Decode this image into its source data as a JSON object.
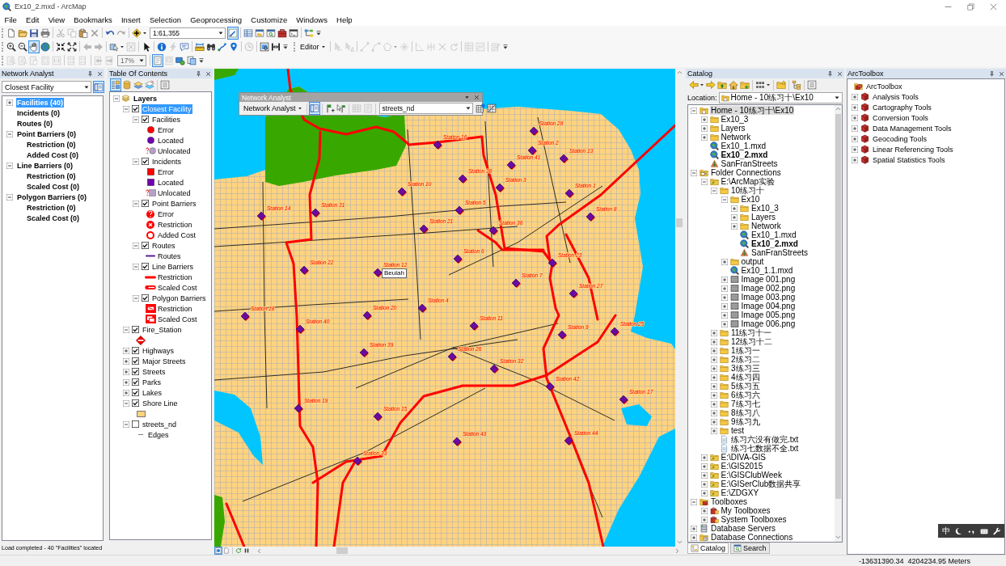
{
  "window": {
    "title": "Ex10_2.mxd - ArcMap"
  },
  "menu": [
    "File",
    "Edit",
    "View",
    "Bookmarks",
    "Insert",
    "Selection",
    "Geoprocessing",
    "Customize",
    "Windows",
    "Help"
  ],
  "toolbar_rows": [
    [
      {
        "items": [
          {
            "kind": "new",
            "selected": false,
            "disabled": false
          },
          {
            "kind": "open",
            "selected": false,
            "disabled": false
          },
          {
            "kind": "save",
            "selected": false,
            "disabled": false
          },
          {
            "kind": "print",
            "selected": false,
            "disabled": false
          },
          {
            "kind": "sep"
          },
          {
            "kind": "cut",
            "selected": false,
            "disabled": true
          },
          {
            "kind": "copy",
            "selected": false,
            "disabled": true
          },
          {
            "kind": "paste",
            "selected": false,
            "disabled": false
          },
          {
            "kind": "delete",
            "selected": false,
            "disabled": true
          },
          {
            "kind": "sep"
          },
          {
            "kind": "undo",
            "selected": false,
            "disabled": false
          },
          {
            "kind": "redo",
            "selected": false,
            "disabled": true
          },
          {
            "kind": "sep"
          },
          {
            "kind": "adddata",
            "selected": false,
            "disabled": false,
            "dropdown": true
          },
          {
            "kind": "combo",
            "value": "1:61,355",
            "disabled": false
          },
          {
            "kind": "editortb",
            "selected": true,
            "disabled": false
          },
          {
            "kind": "sep"
          },
          {
            "kind": "table",
            "selected": false,
            "disabled": false
          },
          {
            "kind": "catalog",
            "selected": false,
            "disabled": false
          },
          {
            "kind": "search",
            "selected": false,
            "disabled": false
          },
          {
            "kind": "toolbox",
            "selected": false,
            "disabled": false
          },
          {
            "kind": "python",
            "selected": false,
            "disabled": false
          },
          {
            "kind": "sep"
          },
          {
            "kind": "model",
            "selected": false,
            "disabled": false
          },
          {
            "kind": "options",
            "selected": false,
            "disabled": false
          }
        ]
      }
    ],
    [
      {
        "items": [
          {
            "kind": "zoomin",
            "selected": false,
            "disabled": false
          },
          {
            "kind": "zoomout",
            "selected": false,
            "disabled": false
          },
          {
            "kind": "pan",
            "selected": true,
            "disabled": false
          },
          {
            "kind": "fullextent",
            "selected": false,
            "disabled": false
          },
          {
            "kind": "sep"
          },
          {
            "kind": "fixedin",
            "selected": false,
            "disabled": false
          },
          {
            "kind": "fixedout",
            "selected": false,
            "disabled": false
          },
          {
            "kind": "sep"
          },
          {
            "kind": "back",
            "selected": false,
            "disabled": true
          },
          {
            "kind": "forward",
            "selected": false,
            "disabled": true
          },
          {
            "kind": "sep"
          },
          {
            "kind": "selectfeat",
            "selected": false,
            "disabled": false,
            "dropdown": true
          },
          {
            "kind": "clearsel",
            "selected": false,
            "disabled": true
          },
          {
            "kind": "sep"
          },
          {
            "kind": "pointer",
            "selected": false,
            "disabled": false
          },
          {
            "kind": "sep"
          },
          {
            "kind": "identify",
            "selected": false,
            "disabled": false
          },
          {
            "kind": "hyperlink",
            "selected": false,
            "disabled": true
          },
          {
            "kind": "popup",
            "selected": false,
            "disabled": false
          },
          {
            "kind": "sep"
          },
          {
            "kind": "measure",
            "selected": false,
            "disabled": false
          },
          {
            "kind": "find",
            "selected": false,
            "disabled": false
          },
          {
            "kind": "route",
            "selected": false,
            "disabled": false
          },
          {
            "kind": "gotoxy",
            "selected": false,
            "disabled": false
          },
          {
            "kind": "sep"
          },
          {
            "kind": "timeslider",
            "selected": false,
            "disabled": true
          },
          {
            "kind": "sep"
          },
          {
            "kind": "viewer",
            "selected": false,
            "disabled": false
          },
          {
            "kind": "swipe",
            "selected": false,
            "disabled": false
          },
          {
            "kind": "options",
            "selected": false,
            "disabled": false
          }
        ]
      },
      {
        "items": [
          {
            "kind": "menu",
            "label": "Editor",
            "disabled": false
          },
          {
            "kind": "sep"
          },
          {
            "kind": "edittool",
            "selected": false,
            "disabled": true
          },
          {
            "kind": "annot",
            "selected": false,
            "disabled": true
          },
          {
            "kind": "sep"
          },
          {
            "kind": "line",
            "selected": false,
            "disabled": true
          },
          {
            "kind": "arc",
            "selected": false,
            "disabled": true
          },
          {
            "kind": "polygon",
            "selected": false,
            "disabled": true,
            "dropdown": true
          },
          {
            "kind": "point",
            "selected": false,
            "disabled": true
          },
          {
            "kind": "sep"
          },
          {
            "kind": "split",
            "selected": false,
            "disabled": true
          },
          {
            "kind": "trace",
            "selected": false,
            "disabled": true
          },
          {
            "kind": "cross",
            "selected": false,
            "disabled": true
          },
          {
            "kind": "rotate",
            "selected": false,
            "disabled": true
          },
          {
            "kind": "sep"
          },
          {
            "kind": "attributes",
            "selected": false,
            "disabled": true
          },
          {
            "kind": "sketch",
            "selected": false,
            "disabled": true
          },
          {
            "kind": "sep"
          },
          {
            "kind": "create",
            "selected": false,
            "disabled": true
          },
          {
            "kind": "options",
            "selected": false,
            "disabled": false
          }
        ]
      }
    ],
    [
      {
        "items": [
          {
            "kind": "lzoomin",
            "selected": false,
            "disabled": true
          },
          {
            "kind": "lzoomout",
            "selected": false,
            "disabled": true
          },
          {
            "kind": "lpan",
            "selected": false,
            "disabled": true
          },
          {
            "kind": "fullpage",
            "selected": false,
            "disabled": true
          },
          {
            "kind": "actual",
            "selected": false,
            "disabled": true
          },
          {
            "kind": "sep"
          },
          {
            "kind": "lfixedin",
            "selected": false,
            "disabled": true
          },
          {
            "kind": "lfixedout",
            "selected": false,
            "disabled": true
          },
          {
            "kind": "sep"
          },
          {
            "kind": "lback",
            "selected": false,
            "disabled": true
          },
          {
            "kind": "lforward",
            "selected": false,
            "disabled": true
          },
          {
            "kind": "combo",
            "value": "17%",
            "disabled": true
          },
          {
            "kind": "sep"
          },
          {
            "kind": "draft",
            "selected": true,
            "disabled": false
          },
          {
            "kind": "focus",
            "selected": false,
            "disabled": true
          },
          {
            "kind": "changelayout",
            "selected": false,
            "disabled": false
          },
          {
            "kind": "ddp",
            "selected": false,
            "disabled": false
          },
          {
            "kind": "options",
            "selected": false,
            "disabled": false
          }
        ]
      }
    ]
  ],
  "network_analyst": {
    "title": "Network Analyst",
    "analysis": "Closest Facility",
    "tools": [
      {
        "kind": "naprops",
        "selected": true,
        "disabled": false
      }
    ],
    "classes": [
      {
        "label": "Facilities (40)",
        "selected": true,
        "expanded": false
      },
      {
        "label": "Incidents (0)",
        "selected": false
      },
      {
        "label": "Routes (0)",
        "selected": false
      },
      {
        "label": "Point Barriers (0)",
        "selected": false,
        "expanded": true,
        "children": [
          {
            "label": "Restriction (0)",
            "selected": false
          },
          {
            "label": "Added Cost (0)",
            "selected": false
          }
        ]
      },
      {
        "label": "Line Barriers (0)",
        "selected": false,
        "expanded": true,
        "children": [
          {
            "label": "Restriction (0)",
            "selected": false
          },
          {
            "label": "Scaled Cost (0)",
            "selected": false
          }
        ]
      },
      {
        "label": "Polygon Barriers (0)",
        "selected": false,
        "expanded": true,
        "children": [
          {
            "label": "Restriction (0)",
            "selected": false
          },
          {
            "label": "Scaled Cost (0)",
            "selected": false
          }
        ]
      }
    ],
    "status": "Load completed - 40 \"Facilities\" located"
  },
  "table_of_contents": {
    "title": "Table Of Contents",
    "tools": [
      {
        "kind": "drawingorder",
        "selected": true,
        "disabled": false
      },
      {
        "kind": "source",
        "selected": false,
        "disabled": false
      },
      {
        "kind": "visibility",
        "selected": false,
        "disabled": false
      },
      {
        "kind": "selection",
        "selected": false,
        "disabled": false
      },
      {
        "kind": "sep"
      },
      {
        "kind": "tocoptions",
        "selected": false,
        "disabled": false
      }
    ],
    "layers": [
      {
        "label": "Layers",
        "selected": false,
        "expanded": true,
        "children": [
          {
            "label": "Closest Facility",
            "checked": true,
            "selected": true,
            "expanded": true,
            "children": [
              {
                "label": "Facilities",
                "checked": true,
                "selected": false,
                "expanded": true,
                "legend": [
                  {
                    "kind": "circle",
                    "color": "#ff0000",
                    "label": "Error"
                  },
                  {
                    "kind": "circle",
                    "color": "#7000b0",
                    "label": "Located"
                  },
                  {
                    "kind": "qcircle",
                    "color": "#b4a0c8",
                    "label": "Unlocated"
                  }
                ]
              },
              {
                "label": "Incidents",
                "checked": true,
                "selected": false,
                "expanded": true,
                "legend": [
                  {
                    "kind": "square",
                    "color": "#ff0000",
                    "label": "Error"
                  },
                  {
                    "kind": "square",
                    "color": "#7000b0",
                    "label": "Located"
                  },
                  {
                    "kind": "qsquare",
                    "color": "#b4a0c8",
                    "label": "Unlocated"
                  }
                ]
              },
              {
                "label": "Point Barriers",
                "checked": true,
                "selected": false,
                "expanded": true,
                "legend": [
                  {
                    "kind": "helpdot",
                    "color": "#ff0000",
                    "label": "Error"
                  },
                  {
                    "kind": "xdot",
                    "color": "#ff0000",
                    "label": "Restriction"
                  },
                  {
                    "kind": "ring",
                    "color": "#ff0000",
                    "label": "Added Cost"
                  }
                ]
              },
              {
                "label": "Routes",
                "checked": true,
                "selected": false,
                "expanded": true,
                "legend": [
                  {
                    "kind": "line",
                    "color": "#5a1e96",
                    "label": "Routes"
                  }
                ]
              },
              {
                "label": "Line Barriers",
                "checked": true,
                "selected": false,
                "expanded": true,
                "legend": [
                  {
                    "kind": "thickline",
                    "color": "#ff0000",
                    "label": "Restriction"
                  },
                  {
                    "kind": "hollowline",
                    "color": "#ff0000",
                    "label": "Scaled Cost"
                  }
                ]
              },
              {
                "label": "Polygon Barriers",
                "checked": true,
                "selected": false,
                "expanded": true,
                "legend": [
                  {
                    "kind": "barbox",
                    "color": "#ff0000",
                    "label": "Restriction"
                  },
                  {
                    "kind": "hatchbox",
                    "color": "#ff0000",
                    "label": "Scaled Cost"
                  }
                ]
              }
            ]
          },
          {
            "label": "Fire_Station",
            "checked": true,
            "selected": false,
            "expanded": true,
            "legend": [
              {
                "kind": "diamond",
                "color": "#e60000"
              }
            ]
          },
          {
            "label": "Highways",
            "checked": true,
            "selected": false,
            "expanded": false
          },
          {
            "label": "Major Streets",
            "checked": true,
            "selected": false,
            "expanded": false
          },
          {
            "label": "Streets",
            "checked": true,
            "selected": false,
            "expanded": false
          },
          {
            "label": "Parks",
            "checked": true,
            "selected": false,
            "expanded": false
          },
          {
            "label": "Lakes",
            "checked": true,
            "selected": false,
            "expanded": false
          },
          {
            "label": "Shore Line",
            "checked": true,
            "selected": false,
            "expanded": true,
            "legend": [
              {
                "kind": "fill",
                "color": "#ffd37f"
              }
            ]
          },
          {
            "label": "streets_nd",
            "checked": false,
            "selected": false,
            "expanded": true,
            "legend": [
              {
                "kind": "thinline",
                "color": "#808080",
                "label": "Edges"
              }
            ]
          }
        ]
      }
    ]
  },
  "map": {
    "stations": [
      {
        "label": "Station 28"
      },
      {
        "label": "Station 16"
      },
      {
        "label": "Station 2"
      },
      {
        "label": "Station 13"
      },
      {
        "label": "Station 41"
      },
      {
        "label": "Station 38"
      },
      {
        "label": "Station 3"
      },
      {
        "label": "Station 10"
      },
      {
        "label": "Station 1"
      },
      {
        "label": "Station 5"
      },
      {
        "label": "Station 8"
      },
      {
        "label": "Station 14"
      },
      {
        "label": "Station 31"
      },
      {
        "label": "Station 21"
      },
      {
        "label": "Station 36"
      },
      {
        "label": "Station 6"
      },
      {
        "label": "Station 22"
      },
      {
        "label": "Station 12"
      },
      {
        "label": "Station 23"
      },
      {
        "label": "Station 7"
      },
      {
        "label": "Station 27"
      },
      {
        "label": "Station 18"
      },
      {
        "label": "Station 20"
      },
      {
        "label": "Station 4"
      },
      {
        "label": "Station 11"
      },
      {
        "label": "Station 40"
      },
      {
        "label": "Station 39"
      },
      {
        "label": "Station 26"
      },
      {
        "label": "Station 32"
      },
      {
        "label": "Station 9"
      },
      {
        "label": "Station 25"
      },
      {
        "label": "Station 42"
      },
      {
        "label": "Station 17"
      },
      {
        "label": "Station 19"
      },
      {
        "label": "Station 15"
      },
      {
        "label": "Station 43"
      },
      {
        "label": "Station 44"
      },
      {
        "label": "Station 33"
      }
    ],
    "map_tip": "Beulah",
    "view_buttons": [
      {
        "kind": "dataview",
        "selected": true,
        "disabled": false
      },
      {
        "kind": "layoutview",
        "selected": false,
        "disabled": false
      },
      {
        "kind": "sep"
      },
      {
        "kind": "refresh",
        "selected": false,
        "disabled": false
      },
      {
        "kind": "pause",
        "selected": false,
        "disabled": false
      }
    ],
    "network_analyst_toolbar": {
      "title": "Network Analyst",
      "items": [
        {
          "kind": "menu",
          "label": "Network Analyst",
          "disabled": false
        },
        {
          "kind": "sep"
        },
        {
          "kind": "nawindow",
          "selected": true,
          "disabled": false
        },
        {
          "kind": "sep"
        },
        {
          "kind": "createloc",
          "selected": false,
          "disabled": false
        },
        {
          "kind": "selectloc",
          "selected": false,
          "disabled": false
        },
        {
          "kind": "sep"
        },
        {
          "kind": "solve",
          "selected": false,
          "disabled": true
        },
        {
          "kind": "directions",
          "selected": false,
          "disabled": true
        },
        {
          "kind": "sep"
        },
        {
          "kind": "combo",
          "value": "streets_nd",
          "disabled": false
        },
        {
          "kind": "netident",
          "selected": false,
          "disabled": false
        },
        {
          "kind": "build",
          "selected": false,
          "disabled": false
        }
      ]
    }
  },
  "catalog": {
    "title": "Catalog",
    "tools": [
      {
        "kind": "cback",
        "selected": false,
        "disabled": false,
        "dropdown": true
      },
      {
        "kind": "cforward",
        "selected": false,
        "disabled": false
      },
      {
        "kind": "up",
        "selected": false,
        "disabled": false
      },
      {
        "kind": "home",
        "selected": false,
        "disabled": false
      },
      {
        "kind": "connect",
        "selected": false,
        "disabled": false
      },
      {
        "kind": "sep"
      },
      {
        "kind": "views",
        "selected": false,
        "disabled": false,
        "dropdown": true
      },
      {
        "kind": "sep"
      },
      {
        "kind": "newitem",
        "selected": false,
        "disabled": false
      },
      {
        "kind": "sep"
      },
      {
        "kind": "treeview",
        "selected": false,
        "disabled": false
      },
      {
        "kind": "sep"
      },
      {
        "kind": "coptions",
        "selected": false,
        "disabled": false
      }
    ],
    "location_label": "Location:",
    "location": "Home - 10练习十\\Ex10",
    "tree": [
      {
        "label": "Home - 10练习十\\Ex10",
        "kind": "home",
        "selected": true,
        "expanded": true,
        "children": [
          {
            "label": "Ex10_3",
            "kind": "folder",
            "selected": false,
            "expanded": false
          },
          {
            "label": "Layers",
            "kind": "folder",
            "selected": false,
            "expanded": false
          },
          {
            "label": "Network",
            "kind": "folder",
            "selected": false,
            "expanded": false
          },
          {
            "label": "Ex10_1.mxd",
            "kind": "mxd",
            "selected": false,
            "open": false
          },
          {
            "label": "Ex10_2.mxd",
            "kind": "mxd",
            "selected": false,
            "open": true
          },
          {
            "label": "SanFranStreets",
            "kind": "network",
            "selected": false
          }
        ]
      },
      {
        "label": "Folder Connections",
        "kind": "folderconn",
        "selected": false,
        "expanded": true,
        "children": [
          {
            "label": "E:\\ArcMap实验",
            "kind": "connfolder",
            "selected": false,
            "expanded": true,
            "children": [
              {
                "label": "10练习十",
                "kind": "folder",
                "selected": false,
                "expanded": true,
                "children": [
                  {
                    "label": "Ex10",
                    "kind": "folder",
                    "selected": false,
                    "expanded": true,
                    "children": [
                      {
                        "label": "Ex10_3",
                        "kind": "folder",
                        "selected": false,
                        "expanded": false
                      },
                      {
                        "label": "Layers",
                        "kind": "folder",
                        "selected": false,
                        "expanded": false
                      },
                      {
                        "label": "Network",
                        "kind": "folder",
                        "selected": false,
                        "expanded": false
                      },
                      {
                        "label": "Ex10_1.mxd",
                        "kind": "mxd",
                        "selected": false,
                        "open": false
                      },
                      {
                        "label": "Ex10_2.mxd",
                        "kind": "mxd",
                        "selected": false,
                        "open": true
                      },
                      {
                        "label": "SanFranStreets",
                        "kind": "network",
                        "selected": false
                      }
                    ]
                  },
                  {
                    "label": "output",
                    "kind": "folder",
                    "selected": false,
                    "expanded": false
                  },
                  {
                    "label": "Ex10_1.1.mxd",
                    "kind": "mxd",
                    "selected": false,
                    "open": false
                  },
                  {
                    "label": "Image 001.png",
                    "kind": "raster",
                    "selected": false,
                    "expanded": false
                  },
                  {
                    "label": "Image 002.png",
                    "kind": "raster",
                    "selected": false,
                    "expanded": false
                  },
                  {
                    "label": "Image 003.png",
                    "kind": "raster",
                    "selected": false,
                    "expanded": false
                  },
                  {
                    "label": "Image 004.png",
                    "kind": "raster",
                    "selected": false,
                    "expanded": false
                  },
                  {
                    "label": "Image 005.png",
                    "kind": "raster",
                    "selected": false,
                    "expanded": false
                  },
                  {
                    "label": "Image 006.png",
                    "kind": "raster",
                    "selected": false,
                    "expanded": false
                  }
                ]
              },
              {
                "label": "11练习十一",
                "kind": "folder",
                "selected": false,
                "expanded": false
              },
              {
                "label": "12练习十二",
                "kind": "folder",
                "selected": false,
                "expanded": false
              },
              {
                "label": "1练习一",
                "kind": "folder",
                "selected": false,
                "expanded": false
              },
              {
                "label": "2练习二",
                "kind": "folder",
                "selected": false,
                "expanded": false
              },
              {
                "label": "3练习三",
                "kind": "folder",
                "selected": false,
                "expanded": false
              },
              {
                "label": "4练习四",
                "kind": "folder",
                "selected": false,
                "expanded": false
              },
              {
                "label": "5练习五",
                "kind": "folder",
                "selected": false,
                "expanded": false
              },
              {
                "label": "6练习六",
                "kind": "folder",
                "selected": false,
                "expanded": false
              },
              {
                "label": "7练习七",
                "kind": "folder",
                "selected": false,
                "expanded": false
              },
              {
                "label": "8练习八",
                "kind": "folder",
                "selected": false,
                "expanded": false
              },
              {
                "label": "9练习九",
                "kind": "folder",
                "selected": false,
                "expanded": false
              },
              {
                "label": "test",
                "kind": "folder",
                "selected": false,
                "expanded": false
              },
              {
                "label": "练习六没有做完.txt",
                "kind": "txt",
                "selected": false
              },
              {
                "label": "练习七数据不全.txt",
                "kind": "txt",
                "selected": false
              }
            ]
          },
          {
            "label": "E:\\DIVA-GIS",
            "kind": "connfolder",
            "selected": false,
            "expanded": false
          },
          {
            "label": "E:\\GIS2015",
            "kind": "connfolder",
            "selected": false,
            "expanded": false
          },
          {
            "label": "E:\\GISClubWeek",
            "kind": "connfolder",
            "selected": false,
            "expanded": false
          },
          {
            "label": "E:\\GISerClub数据共享",
            "kind": "connfolder",
            "selected": false,
            "expanded": false
          },
          {
            "label": "E:\\ZDGXY",
            "kind": "connfolder",
            "selected": false,
            "expanded": false
          }
        ]
      },
      {
        "label": "Toolboxes",
        "kind": "toolboxes",
        "selected": false,
        "expanded": true,
        "children": [
          {
            "label": "My Toolboxes",
            "kind": "toolboxfolder",
            "selected": false,
            "expanded": false
          },
          {
            "label": "System Toolboxes",
            "kind": "toolboxfolder",
            "selected": false,
            "expanded": false
          }
        ]
      },
      {
        "label": "Database Servers",
        "kind": "dbservers",
        "selected": false,
        "expanded": false
      },
      {
        "label": "Database Connections",
        "kind": "dbconn",
        "selected": false,
        "expanded": false
      }
    ],
    "tabs": [
      {
        "label": "Catalog",
        "kind": "catalog",
        "selected": true
      },
      {
        "label": "Search",
        "kind": "search",
        "selected": false
      }
    ]
  },
  "arctoolbox": {
    "title": "ArcToolbox",
    "tree": [
      {
        "label": "ArcToolbox",
        "kind": "root",
        "selected": false,
        "children": [
          {
            "label": "Analysis Tools",
            "kind": "toolbox",
            "selected": false,
            "expanded": false
          },
          {
            "label": "Cartography Tools",
            "kind": "toolbox",
            "selected": false,
            "expanded": false
          },
          {
            "label": "Conversion Tools",
            "kind": "toolbox",
            "selected": false,
            "expanded": false
          },
          {
            "label": "Data Management Tools",
            "kind": "toolbox",
            "selected": false,
            "expanded": false
          },
          {
            "label": "Geocoding Tools",
            "kind": "toolbox",
            "selected": false,
            "expanded": false
          },
          {
            "label": "Linear Referencing Tools",
            "kind": "toolbox",
            "selected": false,
            "expanded": false
          },
          {
            "label": "Spatial Statistics Tools",
            "kind": "toolbox",
            "selected": false,
            "expanded": false
          }
        ]
      }
    ]
  },
  "ime_bar": {
    "mode": "中"
  },
  "status_bar": {
    "coordinates": "-13631390.34  4204234.95 Meters"
  }
}
